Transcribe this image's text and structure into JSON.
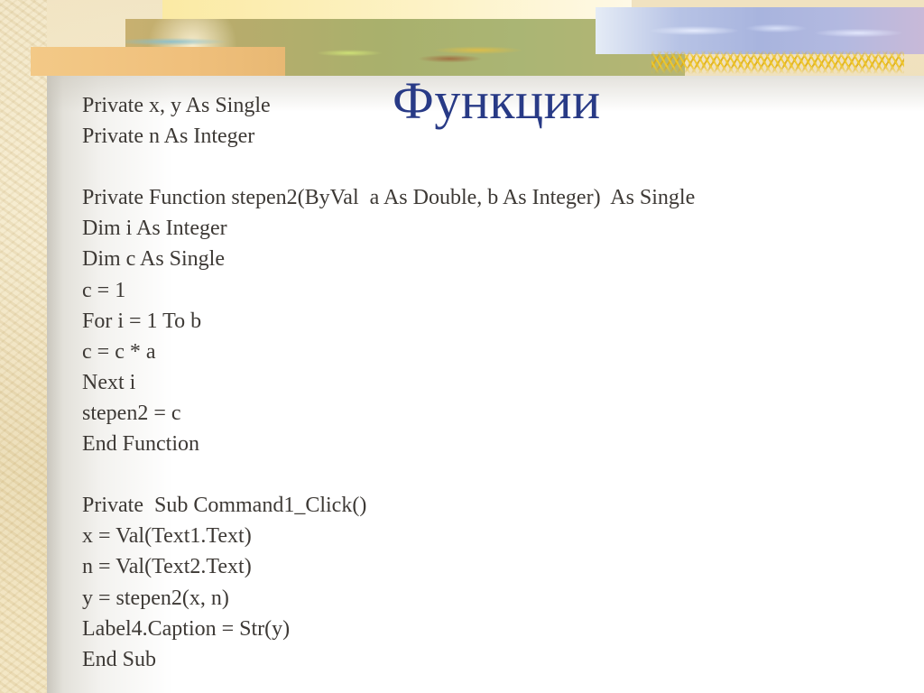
{
  "slide": {
    "title": "Функции",
    "title_color": "#283a86",
    "code_lines": [
      "Private x, y As Single",
      "Private n As Integer",
      "",
      "Private Function stepen2(ByVal  a As Double, b As Integer)  As Single",
      "Dim i As Integer",
      "Dim c As Single",
      "c = 1",
      "For i = 1 To b",
      "c = c * a",
      "Next i",
      "stepen2 = c",
      "End Function",
      "",
      "Private  Sub Command1_Click()",
      "x = Val(Text1.Text)",
      "n = Val(Text2.Text)",
      "y = stepen2(x, n)",
      "Label4.Caption = Str(y)",
      "End Sub"
    ]
  }
}
